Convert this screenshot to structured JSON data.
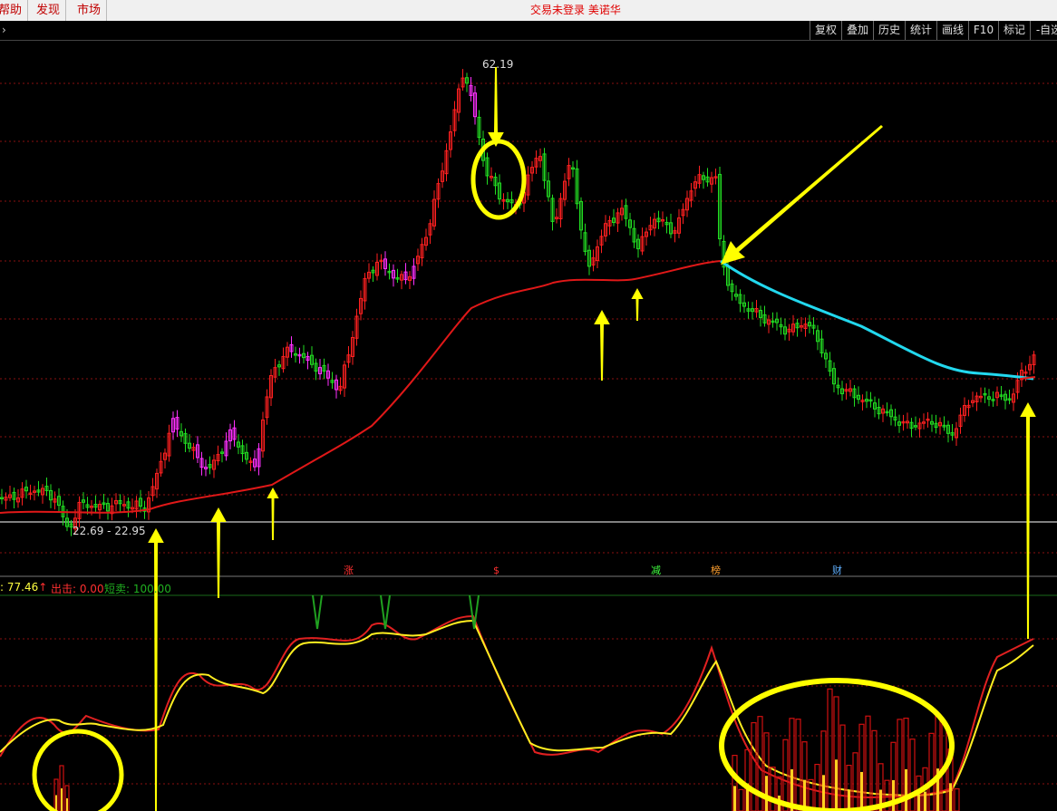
{
  "menubar": {
    "items": [
      {
        "label": "帮助"
      },
      {
        "label": "发现"
      },
      {
        "label": "市场"
      }
    ],
    "status_text": "交易未登录 美诺华"
  },
  "toolbar": {
    "buttons": [
      {
        "label": "复权"
      },
      {
        "label": "叠加"
      },
      {
        "label": "历史"
      },
      {
        "label": "统计"
      },
      {
        "label": "画线"
      },
      {
        "label": "F10"
      },
      {
        "label": "标记"
      },
      {
        "label": "-自选"
      }
    ]
  },
  "main_chart": {
    "high_price_label": "62.19",
    "range_label": "22.69 - 22.95",
    "event_tags": [
      "涨",
      "$",
      "减",
      "榜",
      "财"
    ]
  },
  "indicator": {
    "label_value": "77.46",
    "label_chu": "出击: 0.00",
    "label_duanmai": "短卖: 100.00"
  },
  "colors": {
    "up": "#ff2020",
    "down": "#22dd22",
    "ma_red": "#e01818",
    "ma_cyan": "#22d8ee",
    "annotation": "#ffff00",
    "magenta": "#ff30ff"
  }
}
